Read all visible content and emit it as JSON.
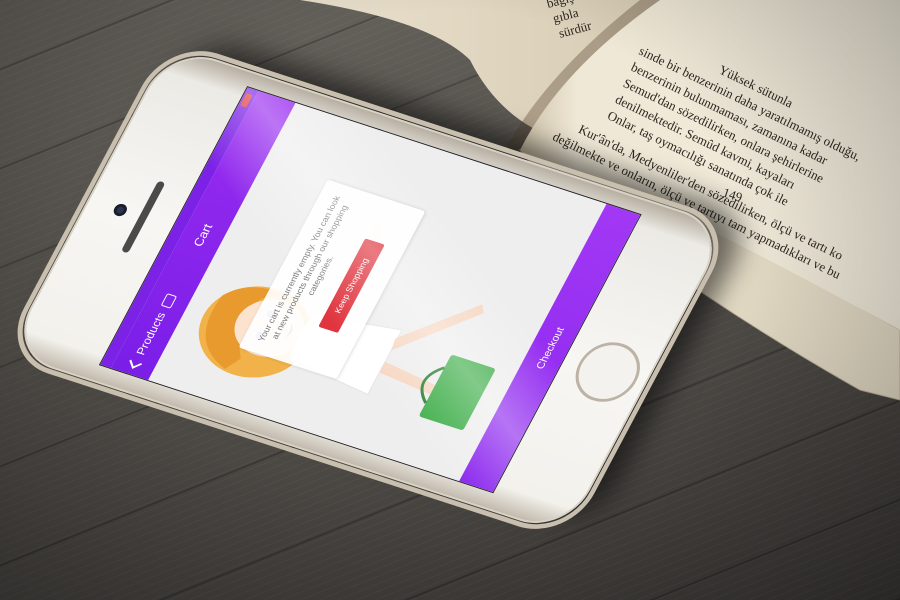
{
  "scene": {
    "surface": "dark wooden table",
    "colors": {
      "accent": "#8a26ee",
      "button_red": "#e0343f",
      "wood": "#55524d"
    }
  },
  "book": {
    "page_number": "149",
    "text_lines": [
      "Yüksek sütunla",
      "sinde bir benzerinin daha yaratılmamış olduğu,",
      "benzerinin bulunmaması, zamanına kadar",
      "Semud'dan sözedilirken, onlara şehirlerine",
      "denilmektedir. Semûd kavmi, kayaları",
      "Onlar, taş oymacılığı sanatında çok ile",
      "Kur'ân'da, Medyenliler'den sözedilirken, ölçü ve tartı ko",
      "değilmekte ve onların, ölçü ve tartıyı tam yapmadıkları ve bu"
    ],
    "left_page_lines": [
      "bağış",
      "gıbla",
      "sürdür"
    ]
  },
  "app": {
    "nav": {
      "back_label": "Products",
      "title": "Cart",
      "back_icon": "chevron-left-icon",
      "products_icon": "grid-icon"
    },
    "cart": {
      "empty_message": "Your cart is currently empty. You can look at new products through our shopping categories.",
      "keep_shopping_label": "Keep Shopping"
    },
    "checkout_label": "Checkout",
    "status": {
      "battery_icon": "battery-icon"
    }
  }
}
